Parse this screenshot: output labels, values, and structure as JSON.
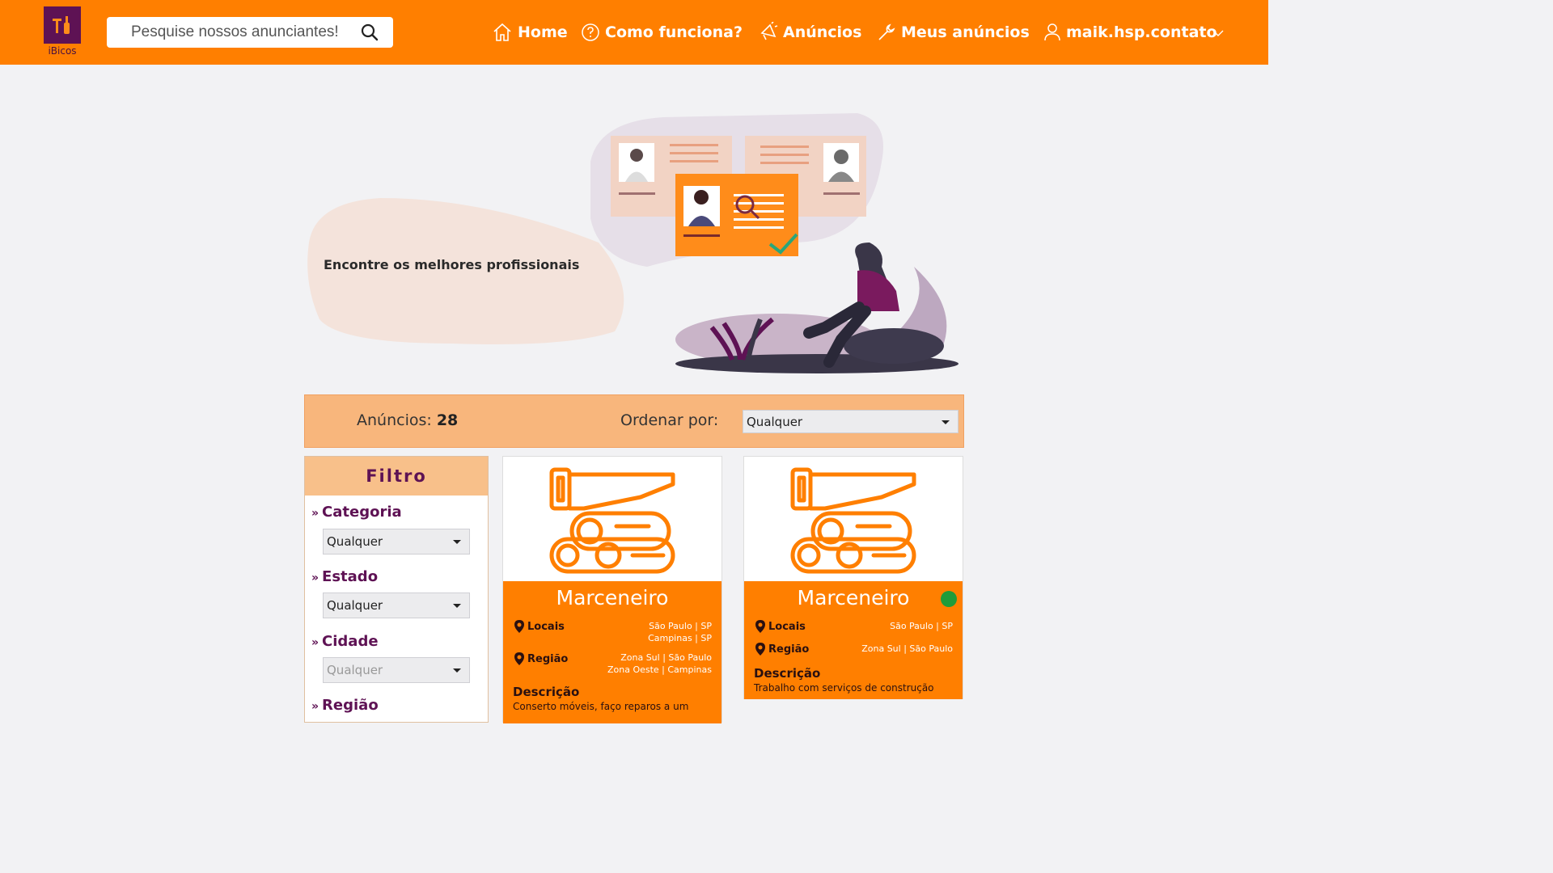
{
  "brand": {
    "name": "iBicos"
  },
  "search": {
    "placeholder": "Pesquise nossos anunciantes!"
  },
  "nav": [
    {
      "label": "Home",
      "icon": "home-icon"
    },
    {
      "label": "Como funciona?",
      "icon": "question-icon"
    },
    {
      "label": "Anúncios",
      "icon": "megaphone-icon"
    },
    {
      "label": "Meus anúncios",
      "icon": "wrench-icon"
    },
    {
      "label": "maik.hsp.contato",
      "icon": "user-icon"
    }
  ],
  "hero": {
    "text": "Encontre os melhores profissionais"
  },
  "listing": {
    "count_label": "Anúncios:",
    "count": "28",
    "order_label": "Ordenar por:",
    "order_value": "Qualquer"
  },
  "filter": {
    "title": "Filtro",
    "fields": [
      {
        "label": "Categoria",
        "value": "Qualquer"
      },
      {
        "label": "Estado",
        "value": "Qualquer"
      },
      {
        "label": "Cidade",
        "value": "Qualquer"
      },
      {
        "label": "Região"
      }
    ]
  },
  "cards": [
    {
      "title": "Marceneiro",
      "locais_label": "Locais",
      "locais": [
        "São Paulo | SP",
        "Campinas | SP"
      ],
      "regiao_label": "Região",
      "regiao": [
        "Zona Sul | São Paulo",
        "Zona Oeste | Campinas"
      ],
      "descricao_label": "Descrição",
      "descricao": "Conserto móveis, faço reparos a um"
    },
    {
      "title": "Marceneiro",
      "online": true,
      "locais_label": "Locais",
      "locais": [
        "São Paulo | SP"
      ],
      "regiao_label": "Região",
      "regiao": [
        "Zona Sul | São Paulo"
      ],
      "descricao_label": "Descrição",
      "descricao": "Trabalho com serviços de construção"
    }
  ],
  "colors": {
    "primary": "#ff7f00",
    "brand_purple": "#5e1254",
    "online": "#1f9c3a"
  }
}
